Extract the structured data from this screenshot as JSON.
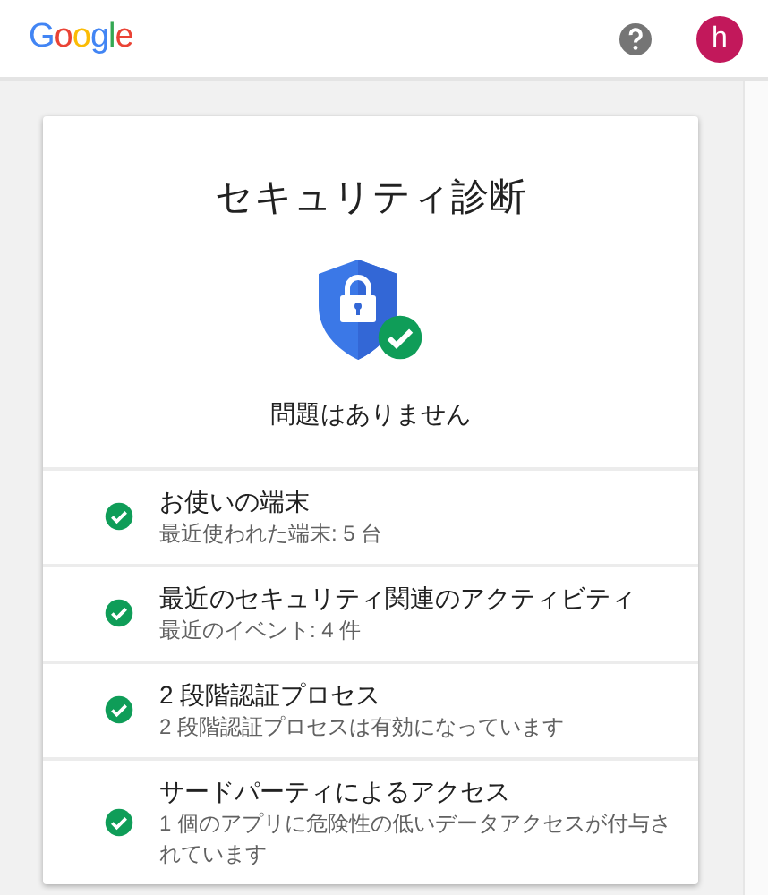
{
  "header": {
    "logo": "Google",
    "avatar_letter": "h"
  },
  "card": {
    "title": "セキュリティ診断",
    "summary": "問題はありません",
    "passed": true,
    "items": [
      {
        "title": "お使いの端末",
        "detail": "最近使われた端末: 5 台",
        "passed": true
      },
      {
        "title": "最近のセキュリティ関連のアクティビティ",
        "detail": "最近のイベント: 4 件",
        "passed": true
      },
      {
        "title": "2 段階認証プロセス",
        "detail": "2 段階認証プロセスは有効になっています",
        "passed": true
      },
      {
        "title": "サードパーティによるアクセス",
        "detail": "1 個のアプリに危険性の低いデータアクセスが付与されています",
        "passed": true
      }
    ]
  }
}
